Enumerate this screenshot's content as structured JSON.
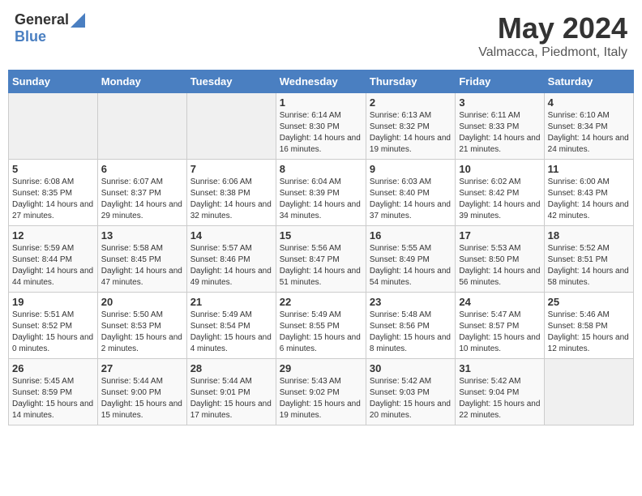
{
  "logo": {
    "general": "General",
    "blue": "Blue"
  },
  "title": {
    "month_year": "May 2024",
    "location": "Valmacca, Piedmont, Italy"
  },
  "days_of_week": [
    "Sunday",
    "Monday",
    "Tuesday",
    "Wednesday",
    "Thursday",
    "Friday",
    "Saturday"
  ],
  "weeks": [
    [
      {
        "day": "",
        "sunrise": "",
        "sunset": "",
        "daylight": ""
      },
      {
        "day": "",
        "sunrise": "",
        "sunset": "",
        "daylight": ""
      },
      {
        "day": "",
        "sunrise": "",
        "sunset": "",
        "daylight": ""
      },
      {
        "day": "1",
        "sunrise": "6:14 AM",
        "sunset": "8:30 PM",
        "daylight": "14 hours and 16 minutes."
      },
      {
        "day": "2",
        "sunrise": "6:13 AM",
        "sunset": "8:32 PM",
        "daylight": "14 hours and 19 minutes."
      },
      {
        "day": "3",
        "sunrise": "6:11 AM",
        "sunset": "8:33 PM",
        "daylight": "14 hours and 21 minutes."
      },
      {
        "day": "4",
        "sunrise": "6:10 AM",
        "sunset": "8:34 PM",
        "daylight": "14 hours and 24 minutes."
      }
    ],
    [
      {
        "day": "5",
        "sunrise": "6:08 AM",
        "sunset": "8:35 PM",
        "daylight": "14 hours and 27 minutes."
      },
      {
        "day": "6",
        "sunrise": "6:07 AM",
        "sunset": "8:37 PM",
        "daylight": "14 hours and 29 minutes."
      },
      {
        "day": "7",
        "sunrise": "6:06 AM",
        "sunset": "8:38 PM",
        "daylight": "14 hours and 32 minutes."
      },
      {
        "day": "8",
        "sunrise": "6:04 AM",
        "sunset": "8:39 PM",
        "daylight": "14 hours and 34 minutes."
      },
      {
        "day": "9",
        "sunrise": "6:03 AM",
        "sunset": "8:40 PM",
        "daylight": "14 hours and 37 minutes."
      },
      {
        "day": "10",
        "sunrise": "6:02 AM",
        "sunset": "8:42 PM",
        "daylight": "14 hours and 39 minutes."
      },
      {
        "day": "11",
        "sunrise": "6:00 AM",
        "sunset": "8:43 PM",
        "daylight": "14 hours and 42 minutes."
      }
    ],
    [
      {
        "day": "12",
        "sunrise": "5:59 AM",
        "sunset": "8:44 PM",
        "daylight": "14 hours and 44 minutes."
      },
      {
        "day": "13",
        "sunrise": "5:58 AM",
        "sunset": "8:45 PM",
        "daylight": "14 hours and 47 minutes."
      },
      {
        "day": "14",
        "sunrise": "5:57 AM",
        "sunset": "8:46 PM",
        "daylight": "14 hours and 49 minutes."
      },
      {
        "day": "15",
        "sunrise": "5:56 AM",
        "sunset": "8:47 PM",
        "daylight": "14 hours and 51 minutes."
      },
      {
        "day": "16",
        "sunrise": "5:55 AM",
        "sunset": "8:49 PM",
        "daylight": "14 hours and 54 minutes."
      },
      {
        "day": "17",
        "sunrise": "5:53 AM",
        "sunset": "8:50 PM",
        "daylight": "14 hours and 56 minutes."
      },
      {
        "day": "18",
        "sunrise": "5:52 AM",
        "sunset": "8:51 PM",
        "daylight": "14 hours and 58 minutes."
      }
    ],
    [
      {
        "day": "19",
        "sunrise": "5:51 AM",
        "sunset": "8:52 PM",
        "daylight": "15 hours and 0 minutes."
      },
      {
        "day": "20",
        "sunrise": "5:50 AM",
        "sunset": "8:53 PM",
        "daylight": "15 hours and 2 minutes."
      },
      {
        "day": "21",
        "sunrise": "5:49 AM",
        "sunset": "8:54 PM",
        "daylight": "15 hours and 4 minutes."
      },
      {
        "day": "22",
        "sunrise": "5:49 AM",
        "sunset": "8:55 PM",
        "daylight": "15 hours and 6 minutes."
      },
      {
        "day": "23",
        "sunrise": "5:48 AM",
        "sunset": "8:56 PM",
        "daylight": "15 hours and 8 minutes."
      },
      {
        "day": "24",
        "sunrise": "5:47 AM",
        "sunset": "8:57 PM",
        "daylight": "15 hours and 10 minutes."
      },
      {
        "day": "25",
        "sunrise": "5:46 AM",
        "sunset": "8:58 PM",
        "daylight": "15 hours and 12 minutes."
      }
    ],
    [
      {
        "day": "26",
        "sunrise": "5:45 AM",
        "sunset": "8:59 PM",
        "daylight": "15 hours and 14 minutes."
      },
      {
        "day": "27",
        "sunrise": "5:44 AM",
        "sunset": "9:00 PM",
        "daylight": "15 hours and 15 minutes."
      },
      {
        "day": "28",
        "sunrise": "5:44 AM",
        "sunset": "9:01 PM",
        "daylight": "15 hours and 17 minutes."
      },
      {
        "day": "29",
        "sunrise": "5:43 AM",
        "sunset": "9:02 PM",
        "daylight": "15 hours and 19 minutes."
      },
      {
        "day": "30",
        "sunrise": "5:42 AM",
        "sunset": "9:03 PM",
        "daylight": "15 hours and 20 minutes."
      },
      {
        "day": "31",
        "sunrise": "5:42 AM",
        "sunset": "9:04 PM",
        "daylight": "15 hours and 22 minutes."
      },
      {
        "day": "",
        "sunrise": "",
        "sunset": "",
        "daylight": ""
      }
    ]
  ]
}
